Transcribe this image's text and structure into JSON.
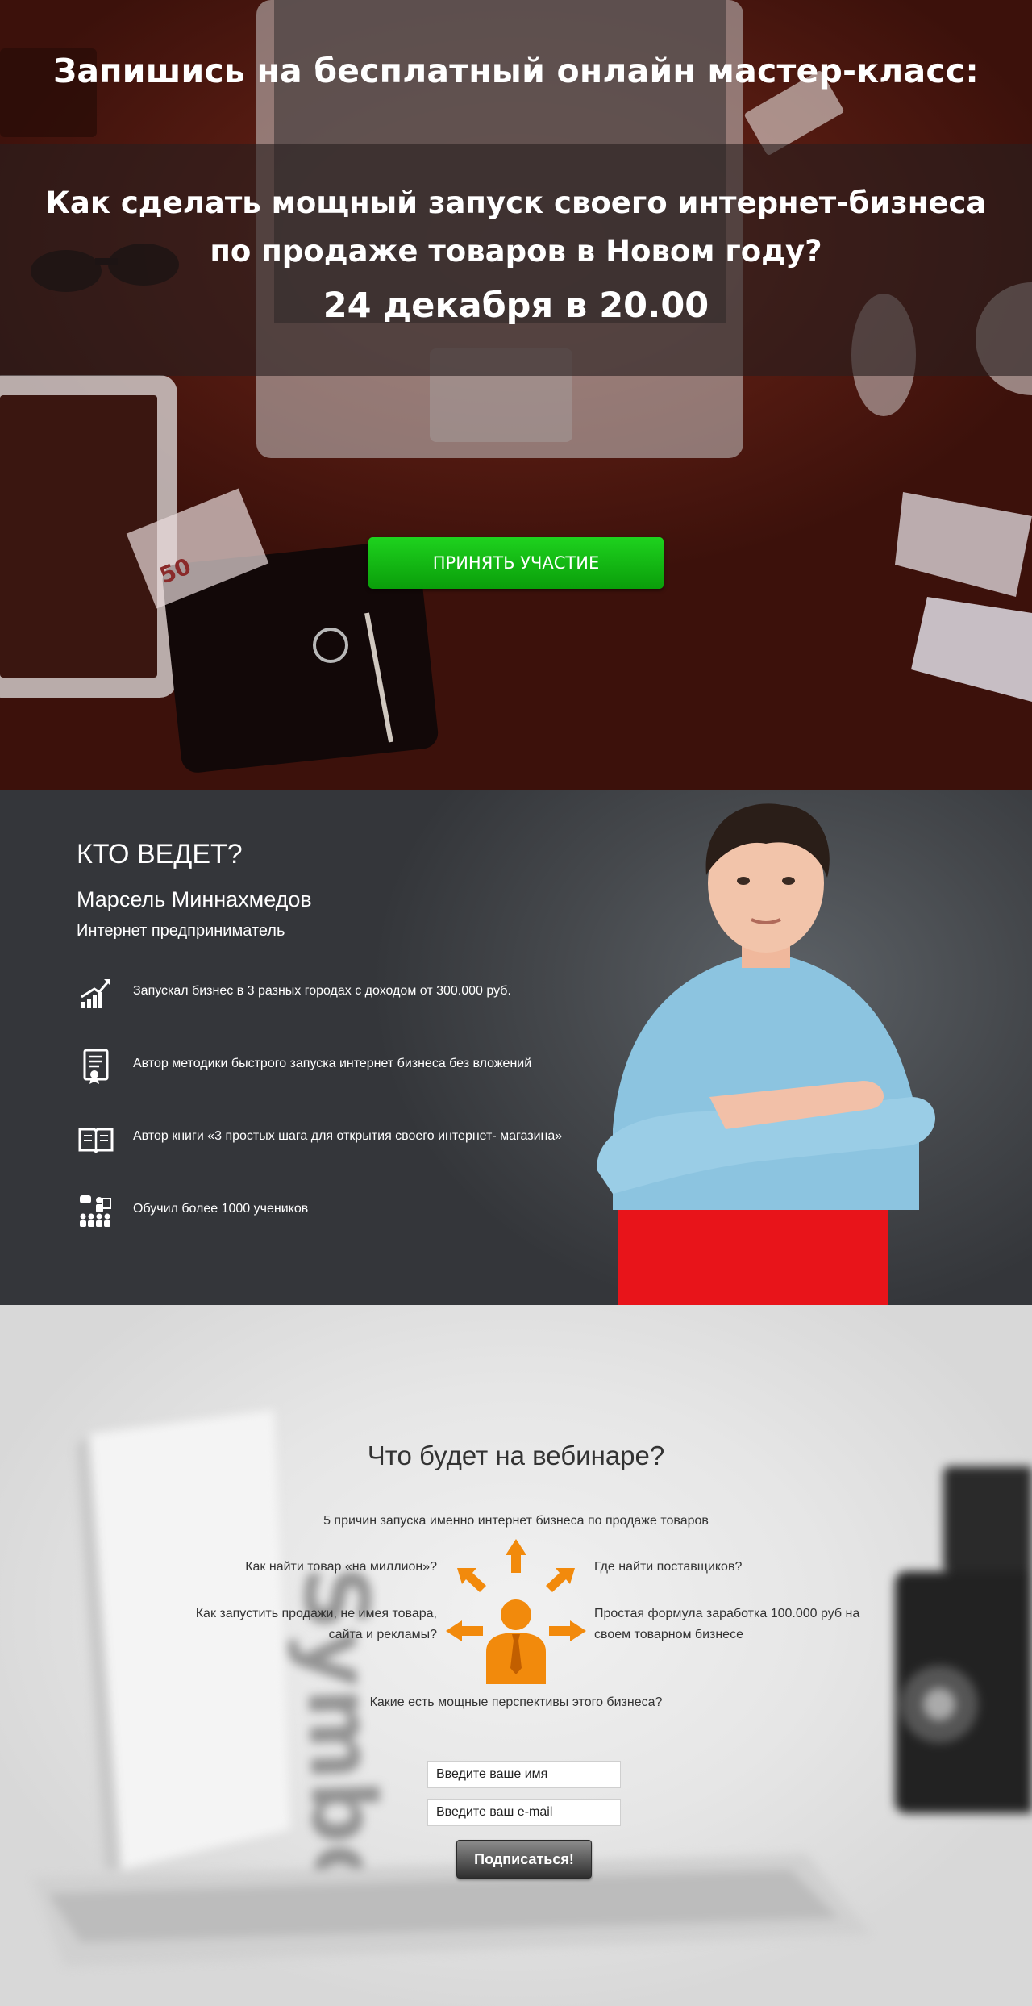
{
  "hero": {
    "title": "Запишись на бесплатный онлайн мастер-класс:",
    "subtitle_line1": "Как сделать мощный запуск своего интернет-бизнеса",
    "subtitle_line2": "по продаже товаров в Новом году?",
    "date": "24 декабря в 20.00",
    "cta_label": "ПРИНЯТЬ УЧАСТИЕ",
    "banknote_value": "50",
    "colors": {
      "cta": "#12b812",
      "band": "#281e1e"
    }
  },
  "presenter": {
    "heading": "КТО ВЕДЕТ?",
    "name": "Марсель Миннахмедов",
    "role": "Интернет предприниматель",
    "features": [
      {
        "icon": "growth-chart-icon",
        "text": "Запускал бизнес в 3 разных городах с доходом от 300.000 руб."
      },
      {
        "icon": "certificate-icon",
        "text": "Автор методики быстрого запуска интернет бизнеса без вложений"
      },
      {
        "icon": "open-book-icon",
        "text": "Автор книги «3 простых шага для открытия своего интернет- магазина»"
      },
      {
        "icon": "audience-icon",
        "text": "Обучил более 1000 учеников"
      }
    ],
    "colors": {
      "chair": "#e8141a",
      "shirt": "#8cc4e0"
    }
  },
  "webinar": {
    "title": "Что будет на вебинаре?",
    "top_item": "5 причин запуска именно интернет бизнеса по продаже товаров",
    "left_item_1": "Как найти товар «на миллион»?",
    "left_item_2": "Как запустить продажи, не имея товара, сайта и рекламы?",
    "right_item_1": "Где найти поставщиков?",
    "right_item_2": "Простая формула заработка 100.000 руб на своем товарном бизнесе",
    "bottom_item": "Какие есть мощные перспективы этого бизнеса?",
    "figure_icon": "businessman-arrows-icon",
    "name_placeholder": "Введите ваше имя",
    "email_placeholder": "Введите ваш e-mail",
    "subscribe_label": "Подписаться!",
    "colors": {
      "accent": "#f28a0c"
    }
  }
}
